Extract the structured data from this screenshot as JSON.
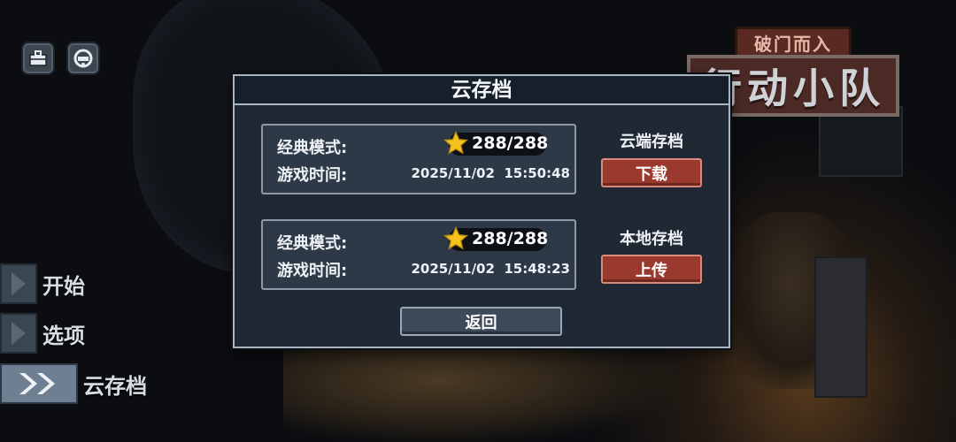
{
  "logo": {
    "top_text": "破门而入",
    "main_text": "行动小队"
  },
  "top_buttons": [
    {
      "icon": "briefcase-icon"
    },
    {
      "icon": "helmet-icon"
    }
  ],
  "menu": {
    "items": [
      {
        "label": "开始",
        "active": false
      },
      {
        "label": "选项",
        "active": false
      },
      {
        "label": "云存档",
        "active": true
      }
    ]
  },
  "dialog": {
    "title": "云存档",
    "cloud_save": {
      "mode_label": "经典模式:",
      "stars": "288/288",
      "time_label": "游戏时间:",
      "time_value": "2025/11/02  15:50:48",
      "side_label": "云端存档",
      "button_label": "下载"
    },
    "local_save": {
      "mode_label": "经典模式:",
      "stars": "288/288",
      "time_label": "游戏时间:",
      "time_value": "2025/11/02  15:48:23",
      "side_label": "本地存档",
      "button_label": "上传"
    },
    "back_label": "返回"
  },
  "colors": {
    "accent_red": "#9a3a2e",
    "panel_bg": "#1f2833",
    "border": "#a8b4bf",
    "star": "#f3c21f"
  }
}
